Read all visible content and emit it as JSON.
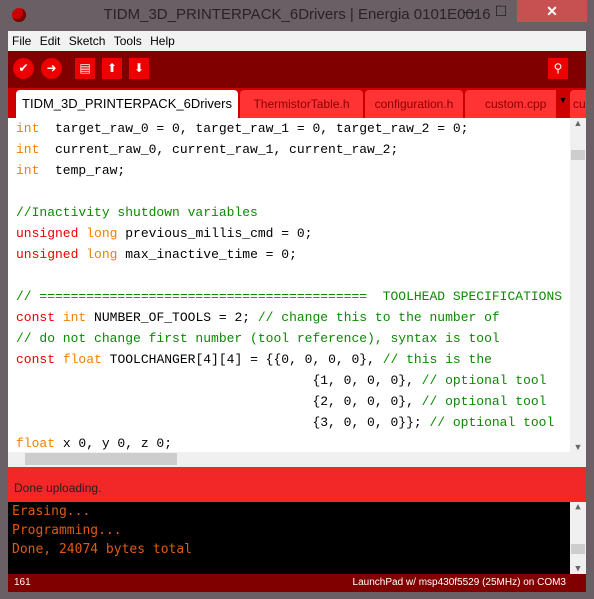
{
  "window": {
    "title": "TIDM_3D_PRINTERPACK_6Drivers | Energia 0101E0016",
    "minimize": "—",
    "maximize": "☐",
    "close": "✕"
  },
  "menu": [
    "File",
    "Edit",
    "Sketch",
    "Tools",
    "Help"
  ],
  "toolbar": {
    "verify": "✔",
    "upload": "➜",
    "new": "▤",
    "open": "⬆",
    "save": "⬇",
    "serial_monitor": "⚲"
  },
  "tabs": [
    "TIDM_3D_PRINTERPACK_6Drivers",
    "ThermistorTable.h",
    "configuration.h",
    "custom.cpp",
    "cu"
  ],
  "tab_menu": "▼",
  "code": [
    [
      [
        "kw2",
        "int"
      ],
      [
        "",
        "  target_raw_0 = 0, target_raw_1 = 0, target_raw_2 = 0;"
      ]
    ],
    [
      [
        "kw2",
        "int"
      ],
      [
        "",
        "  current_raw_0, current_raw_1, current_raw_2;"
      ]
    ],
    [
      [
        "kw2",
        "int"
      ],
      [
        "",
        "  temp_raw;"
      ]
    ],
    [],
    [
      [
        "cm",
        "//Inactivity shutdown variables"
      ]
    ],
    [
      [
        "kw1",
        "unsigned"
      ],
      [
        "",
        " "
      ],
      [
        "kw2",
        "long"
      ],
      [
        "",
        " previous_millis_cmd = 0;"
      ]
    ],
    [
      [
        "kw1",
        "unsigned"
      ],
      [
        "",
        " "
      ],
      [
        "kw2",
        "long"
      ],
      [
        "",
        " max_inactive_time = 0;"
      ]
    ],
    [],
    [
      [
        "cm",
        "// ==========================================  TOOLHEAD SPECIFICATIONS"
      ]
    ],
    [
      [
        "kw1",
        "const"
      ],
      [
        "",
        " "
      ],
      [
        "kw2",
        "int"
      ],
      [
        "",
        " NUMBER_OF_TOOLS = 2; "
      ],
      [
        "cm",
        "// change this to the number of"
      ]
    ],
    [
      [
        "cm",
        "// do not change first number (tool reference), syntax is tool"
      ]
    ],
    [
      [
        "kw1",
        "const"
      ],
      [
        "",
        " "
      ],
      [
        "kw2",
        "float"
      ],
      [
        "",
        " TOOLCHANGER[4][4] = {{0, 0, 0, 0}, "
      ],
      [
        "cm",
        "// this is the"
      ]
    ],
    [
      [
        "",
        "                                      {1, 0, 0, 0}, "
      ],
      [
        "cm",
        "// optional tool"
      ]
    ],
    [
      [
        "",
        "                                      {2, 0, 0, 0}, "
      ],
      [
        "cm",
        "// optional tool"
      ]
    ],
    [
      [
        "",
        "                                      {3, 0, 0, 0}}; "
      ],
      [
        "cm",
        "// optional tool"
      ]
    ],
    [
      [
        "kw2",
        "float"
      ],
      [
        "",
        " x 0, y 0, z 0;"
      ]
    ]
  ],
  "status": "Done uploading.",
  "console": [
    "Erasing...",
    "Programming...",
    "Done, 24074 bytes total"
  ],
  "footer": {
    "line": "161",
    "board": "LaunchPad w/ msp430f5529 (25MHz) on COM3"
  }
}
